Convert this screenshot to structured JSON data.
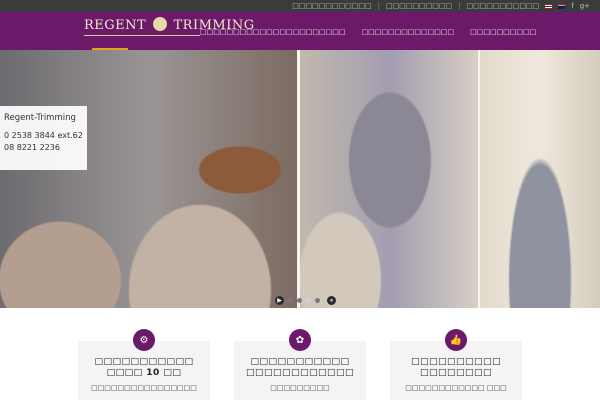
{
  "topbar": {
    "links": [
      "□□□□□□□□□□□□",
      "□□□□□□□□□□",
      "□□□□□□□□□□□"
    ],
    "facebook": "f",
    "google": "g+"
  },
  "header": {
    "logo_left": "REGENT",
    "logo_right": "TRIMMING",
    "nav": [
      "□□□□□□□□□□□□□□□□□□□□□□",
      "□□□□□□□□□□□□□□",
      "□□□□□□□□□□"
    ]
  },
  "hero": {
    "contact": {
      "name": "Regent-Trimming",
      "phone1": "0 2538 3844 ext.62",
      "phone2": "08 8221 2236"
    },
    "controls": {
      "play": "▶",
      "pause": "⏸"
    }
  },
  "features": [
    {
      "icon": "⚙",
      "title_line1": "□□□□□□□□□□□",
      "title_line2": "□□□□ 10 □□",
      "desc": "□□□□□□□□□□□□□□□□"
    },
    {
      "icon": "✿",
      "title_line1": "□□□□□□□□□□□",
      "title_line2": "□□□□□□□□□□□□",
      "desc": "□□□□□□□□□"
    },
    {
      "icon": "👍",
      "title_line1": "□□□□□□□□□□",
      "title_line2": "□□□□□□□□",
      "desc": "□□□□□□□□□□□□ □□□"
    }
  ],
  "colors": {
    "header": "#6b1a69",
    "accent": "#e8a21b",
    "topbar": "#3b3b3b"
  }
}
